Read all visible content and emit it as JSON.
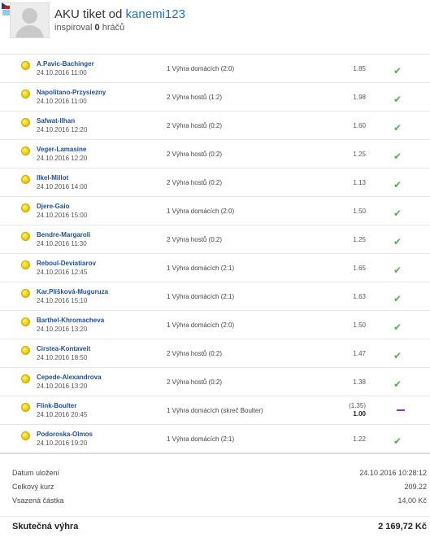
{
  "header": {
    "title_prefix": "AKU tiket od",
    "username": "kanemi123",
    "inspired_label": "inspiroval",
    "inspired_count": "0",
    "inspired_suffix": "hráčů"
  },
  "bets": [
    {
      "match": "A.Pavic-Bachinger",
      "time": "24.10.2016 11:00",
      "tip": "1 Výhra domácích (2:0)",
      "odds": "1.85",
      "status": "won"
    },
    {
      "match": "Napolitano-Przysiezny",
      "time": "24.10.2016 11:00",
      "tip": "2 Výhra hostů (1:2)",
      "odds": "1.98",
      "status": "won"
    },
    {
      "match": "Safwat-Ilhan",
      "time": "24.10.2016 12:20",
      "tip": "2 Výhra hostů (0:2)",
      "odds": "1.60",
      "status": "won"
    },
    {
      "match": "Veger-Lamasine",
      "time": "24.10.2016 12:20",
      "tip": "2 Výhra hostů (0:2)",
      "odds": "1.25",
      "status": "won"
    },
    {
      "match": "Ilkel-Millot",
      "time": "24.10.2016 14:00",
      "tip": "2 Výhra hostů (0:2)",
      "odds": "1.13",
      "status": "won"
    },
    {
      "match": "Djere-Gaio",
      "time": "24.10.2016 15:00",
      "tip": "1 Výhra domácích (2:0)",
      "odds": "1.50",
      "status": "won"
    },
    {
      "match": "Bendre-Margaroli",
      "time": "24.10.2016 11:30",
      "tip": "2 Výhra hostů (0:2)",
      "odds": "1.25",
      "status": "won"
    },
    {
      "match": "Reboul-Deviatiarov",
      "time": "24.10.2016 12:45",
      "tip": "1 Výhra domácích (2:1)",
      "odds": "1.65",
      "status": "won"
    },
    {
      "match": "Kar.Plíšková-Muguruza",
      "time": "24.10.2016 15:10",
      "tip": "1 Výhra domácích (2:1)",
      "odds": "1.63",
      "status": "won"
    },
    {
      "match": "Barthel-Khromacheva",
      "time": "24.10.2016 13:20",
      "tip": "1 Výhra domácích (2:0)",
      "odds": "1.50",
      "status": "won"
    },
    {
      "match": "Cirstea-Kontaveit",
      "time": "24.10.2016 18:50",
      "tip": "2 Výhra hostů (0:2)",
      "odds": "1.47",
      "status": "won"
    },
    {
      "match": "Cepede-Alexandrova",
      "time": "24.10.2016 13:20",
      "tip": "2 Výhra hostů (0:2)",
      "odds": "1.38",
      "status": "won"
    },
    {
      "match": "Flink-Boulter",
      "time": "24.10.2016 20:45",
      "tip": "1 Výhra domácích (skreč Boulter)",
      "odds_original": "(1.35)",
      "odds": "1.00",
      "status": "void"
    },
    {
      "match": "Podoroska-Olmos",
      "time": "24.10.2016 19:20",
      "tip": "1 Výhra domácích (2:1)",
      "odds": "1.22",
      "status": "won"
    }
  ],
  "summary": {
    "saved_label": "Datum uložení",
    "saved_value": "24.10.2016 10:28:12",
    "total_odds_label": "Celkový kurz",
    "total_odds_value": "209.22",
    "stake_label": "Vsazená částka",
    "stake_value": "14,00 Kč",
    "win_label": "Skutečná výhra",
    "win_value": "2 169,72 Kč"
  },
  "colors": {
    "won": "#5aa75a",
    "void": "#8a3bb0",
    "link": "#1f6fb2"
  }
}
